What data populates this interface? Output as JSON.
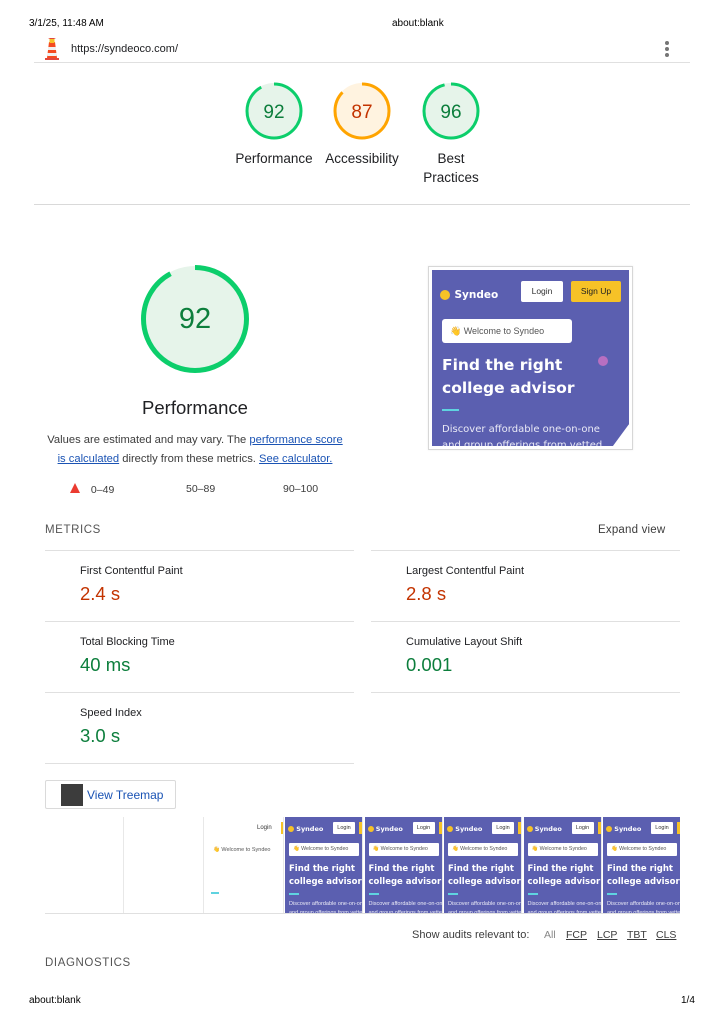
{
  "print_header": {
    "datetime": "3/1/25, 11:48 AM",
    "title": "about:blank"
  },
  "print_footer": {
    "left": "about:blank",
    "page": "1/4"
  },
  "topbar": {
    "url": "https://syndeoco.com/"
  },
  "categories": [
    {
      "score": "92",
      "label": "Performance",
      "status": "pass",
      "fraction": 0.92
    },
    {
      "score": "87",
      "label": "Accessibility",
      "status": "average",
      "fraction": 0.87
    },
    {
      "score": "96",
      "label": "Best Practices",
      "status": "pass",
      "fraction": 0.96
    }
  ],
  "performance": {
    "score": "92",
    "fraction": 0.92,
    "title": "Performance",
    "desc_prefix": "Values are estimated and may vary. The ",
    "desc_link1": "performance score is calculated",
    "desc_mid": " directly from these metrics. ",
    "desc_link2": "See calculator."
  },
  "legend": {
    "fail": "0–49",
    "average": "50–89",
    "pass": "90–100"
  },
  "site_preview": {
    "brand": "Syndeo",
    "login": "Login",
    "signup": "Sign Up",
    "pill": "👋 Welcome to Syndeo",
    "headline_1": "Find the right",
    "headline_2": "college advisor",
    "desc": "Discover affordable one-on-one",
    "desc_2": "and group offerings from vetted"
  },
  "metrics": {
    "heading": "METRICS",
    "expand": "Expand view",
    "items": [
      {
        "label": "First Contentful Paint",
        "value": "2.4 s",
        "status": "average"
      },
      {
        "label": "Largest Contentful Paint",
        "value": "2.8 s",
        "status": "average"
      },
      {
        "label": "Total Blocking Time",
        "value": "40 ms",
        "status": "pass"
      },
      {
        "label": "Cumulative Layout Shift",
        "value": "0.001",
        "status": "pass"
      },
      {
        "label": "Speed Index",
        "value": "3.0 s",
        "status": "pass"
      }
    ]
  },
  "treemap": {
    "label": "View Treemap"
  },
  "filmstrip": {
    "frames": 8,
    "partial_login": "Login",
    "partial_pill": "👋 Welcome to Syndeo"
  },
  "filter": {
    "label": "Show audits relevant to:",
    "items": [
      "All",
      "FCP",
      "LCP",
      "TBT",
      "CLS"
    ]
  },
  "diagnostics": {
    "heading": "DIAGNOSTICS"
  },
  "colors": {
    "pass": "#0c7e3c",
    "pass_arc": "#0cce6b",
    "pass_bg": "#e6f4ea",
    "average": "#c33300",
    "average_arc": "#ffa400",
    "average_bg": "#fff3e0",
    "fail": "#eb3b30",
    "link": "#1a53b4",
    "site_bg": "#5b5fb0",
    "site_accent": "#f6c227"
  }
}
